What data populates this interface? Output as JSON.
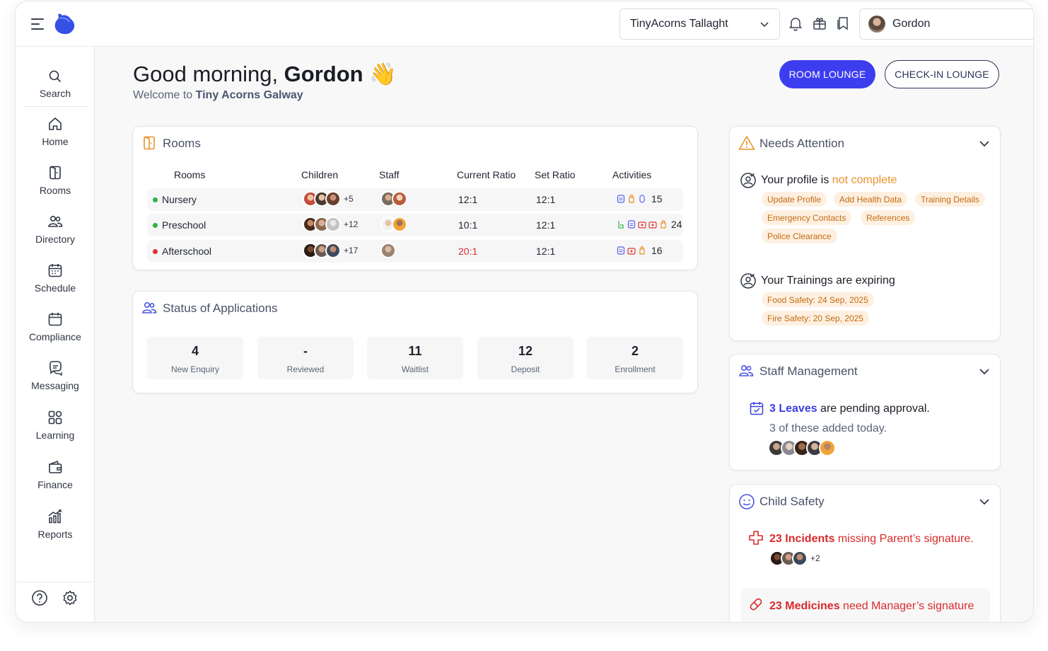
{
  "header": {
    "location": "TinyAcorns Tallaght",
    "user_name": "Gordon"
  },
  "sidebar": {
    "items": [
      {
        "label": "Search",
        "icon": "search-icon"
      },
      {
        "label": "Home",
        "icon": "home-icon"
      },
      {
        "label": "Rooms",
        "icon": "door-icon"
      },
      {
        "label": "Directory",
        "icon": "people-icon"
      },
      {
        "label": "Schedule",
        "icon": "calendar-icon"
      },
      {
        "label": "Compliance",
        "icon": "compliance-icon"
      },
      {
        "label": "Messaging",
        "icon": "chat-icon"
      },
      {
        "label": "Learning",
        "icon": "shapes-icon"
      },
      {
        "label": "Finance",
        "icon": "wallet-icon"
      },
      {
        "label": "Reports",
        "icon": "chart-icon"
      }
    ],
    "bottom": [
      "help-icon",
      "gear-icon"
    ]
  },
  "greeting": {
    "prefix": "Good morning, ",
    "name": "Gordon",
    "emoji": "👋",
    "welcome_prefix": "Welcome to ",
    "center": "Tiny Acorns Galway"
  },
  "actions": {
    "room_lounge": "ROOM LOUNGE",
    "checkin_lounge": "CHECK-IN LOUNGE"
  },
  "rooms": {
    "title": "Rooms",
    "columns": [
      "Rooms",
      "Children",
      "Staff",
      "Current Ratio",
      "Set Ratio",
      "Activities"
    ],
    "rows": [
      {
        "name": "Nursery",
        "status_color": "#2fb344",
        "children_more": "+5",
        "current_ratio": "12:1",
        "set_ratio": "12:1",
        "activities": "15",
        "ratio_alert": false
      },
      {
        "name": "Preschool",
        "status_color": "#2fb344",
        "children_more": "+12",
        "current_ratio": "10:1",
        "set_ratio": "12:1",
        "activities": "24",
        "ratio_alert": false
      },
      {
        "name": "Afterschool",
        "status_color": "#e03131",
        "children_more": "+17",
        "current_ratio": "20:1",
        "set_ratio": "12:1",
        "activities": "16",
        "ratio_alert": true
      }
    ]
  },
  "applications": {
    "title": "Status of Applications",
    "stats": [
      {
        "value": "4",
        "label": "New Enquiry"
      },
      {
        "value": "-",
        "label": "Reviewed"
      },
      {
        "value": "11",
        "label": "Waitlist"
      },
      {
        "value": "12",
        "label": "Deposit"
      },
      {
        "value": "2",
        "label": "Enrollment"
      }
    ]
  },
  "needs_attention": {
    "title": "Needs Attention",
    "profile_prefix": "Your profile is ",
    "profile_status": "not complete",
    "profile_chips": [
      "Update Profile",
      "Add Health Data",
      "Training Details",
      "Emergency Contacts",
      "References",
      "Police Clearance"
    ],
    "trainings_title": "Your Trainings are expiring",
    "training_chips": [
      "Food Safety: 24 Sep, 2025",
      "Fire Safety: 20 Sep, 2025"
    ]
  },
  "staff_management": {
    "title": "Staff Management",
    "leaves_count": "3 Leaves",
    "leaves_text": " are pending approval.",
    "added_today": "3 of these added today."
  },
  "child_safety": {
    "title": "Child Safety",
    "incidents_count": "23 Incidents",
    "incidents_text": " missing Parent’s signature.",
    "incidents_more": "+2",
    "medicines_count": "23 Medicines",
    "medicines_text": " need Manager’s signature"
  },
  "colors": {
    "accent": "#3d3df0",
    "warning": "#e8912a",
    "danger": "#d92a2a",
    "success": "#2fb344"
  }
}
